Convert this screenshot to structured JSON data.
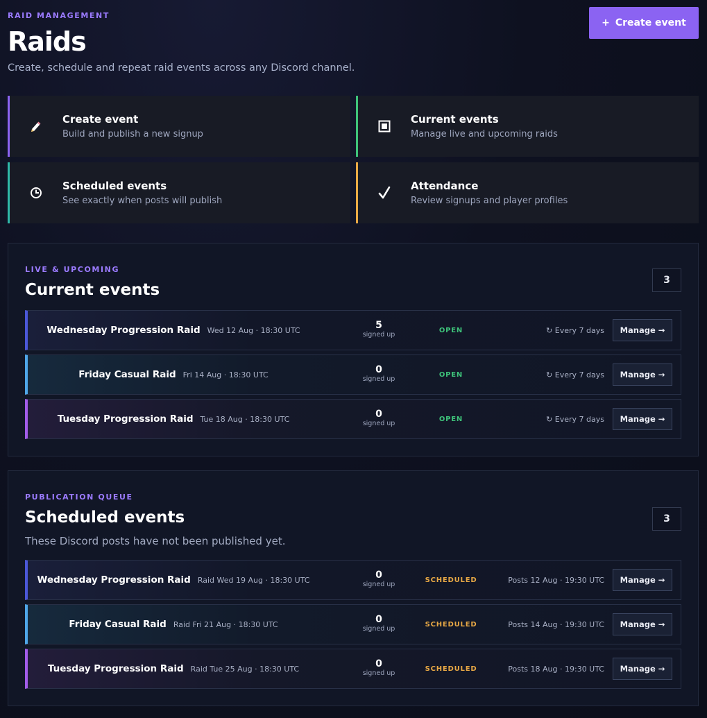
{
  "header": {
    "eyebrow": "RAID MANAGEMENT",
    "title": "Raids",
    "subtitle": "Create, schedule and repeat raid events across any Discord channel.",
    "create_label": "Create event",
    "create_prefix": "+"
  },
  "quick": [
    {
      "title": "Create event",
      "desc": "Build and publish a new signup",
      "icon": "pencil-icon",
      "accent": "#8b63f2"
    },
    {
      "title": "Current events",
      "desc": "Manage live and upcoming raids",
      "icon": "calendar-icon",
      "accent": "#3ec27a"
    },
    {
      "title": "Scheduled events",
      "desc": "See exactly when posts will publish",
      "icon": "clock-icon",
      "accent": "#2fb8a8"
    },
    {
      "title": "Attendance",
      "desc": "Review signups and player profiles",
      "icon": "checkmark-icon",
      "accent": "#e8a845"
    }
  ],
  "current": {
    "eyebrow": "LIVE & UPCOMING",
    "title": "Current events",
    "count": "3",
    "rows": [
      {
        "name": "Wednesday Progression Raid",
        "date": "Wed 12 Aug · 18:30 UTC",
        "count": "5",
        "count_label": "signed up",
        "status": "OPEN",
        "extra": "↻ Every 7 days",
        "manage": "Manage →"
      },
      {
        "name": "Friday Casual Raid",
        "date": "Fri 14 Aug · 18:30 UTC",
        "count": "0",
        "count_label": "signed up",
        "status": "OPEN",
        "extra": "↻ Every 7 days",
        "manage": "Manage →"
      },
      {
        "name": "Tuesday Progression Raid",
        "date": "Tue 18 Aug · 18:30 UTC",
        "count": "0",
        "count_label": "signed up",
        "status": "OPEN",
        "extra": "↻ Every 7 days",
        "manage": "Manage →"
      }
    ]
  },
  "scheduled": {
    "eyebrow": "PUBLICATION QUEUE",
    "title": "Scheduled events",
    "desc": "These Discord posts have not been published yet.",
    "count": "3",
    "rows": [
      {
        "name": "Wednesday Progression Raid",
        "date": "Raid Wed 19 Aug · 18:30 UTC",
        "count": "0",
        "count_label": "signed up",
        "status": "SCHEDULED",
        "extra": "Posts 12 Aug · 19:30 UTC",
        "manage": "Manage →"
      },
      {
        "name": "Friday Casual Raid",
        "date": "Raid Fri 21 Aug · 18:30 UTC",
        "count": "0",
        "count_label": "signed up",
        "status": "SCHEDULED",
        "extra": "Posts 14 Aug · 19:30 UTC",
        "manage": "Manage →"
      },
      {
        "name": "Tuesday Progression Raid",
        "date": "Raid Tue 25 Aug · 18:30 UTC",
        "count": "0",
        "count_label": "signed up",
        "status": "SCHEDULED",
        "extra": "Posts 18 Aug · 19:30 UTC",
        "manage": "Manage →"
      }
    ]
  }
}
